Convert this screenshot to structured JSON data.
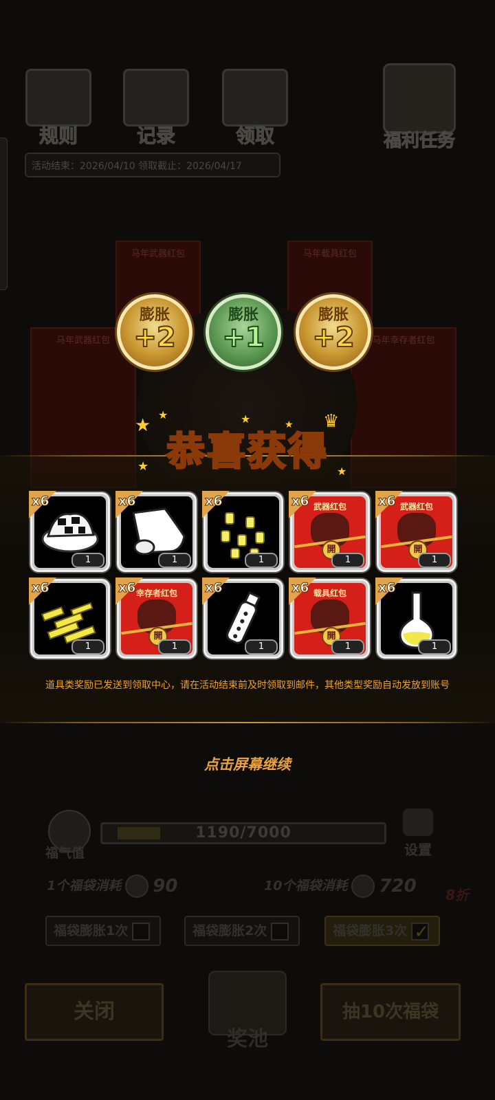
{
  "background": {
    "top_icons": [
      {
        "label": "规则",
        "icon": "rulebook-icon"
      },
      {
        "label": "记录",
        "icon": "record-scroll-icon"
      },
      {
        "label": "领取",
        "icon": "claim-box-icon"
      }
    ],
    "welfare_label": "福利任务",
    "dates": "活动结束：2026/04/10  领取截止：2026/04/17",
    "card_titles": [
      "马年武器红包",
      "马年载具红包",
      "马年武器红包",
      "马年幸存者红包"
    ],
    "bag_label": "開",
    "fortune_label": "福气值",
    "progress_text": "1190/7000",
    "progress_fraction": 0.17,
    "settings_label": "设置",
    "cost_one_label": "1个福袋消耗",
    "cost_one_value": "90",
    "cost_ten_label": "10个福袋消耗",
    "cost_ten_value": "720",
    "coin_label": "福气值",
    "discount": "8折",
    "checkboxes": [
      {
        "label": "福袋膨胀1次",
        "checked": false
      },
      {
        "label": "福袋膨胀2次",
        "checked": false
      },
      {
        "label": "福袋膨胀3次",
        "checked": true
      }
    ],
    "close_label": "关闭",
    "pool_label": "奖池",
    "draw_ten_label": "抽10次福袋"
  },
  "popup": {
    "badges": [
      {
        "word": "膨胀",
        "value": "+2",
        "color": "gold"
      },
      {
        "word": "膨胀",
        "value": "+1",
        "color": "green"
      },
      {
        "word": "膨胀",
        "value": "+2",
        "color": "gold"
      }
    ],
    "title": "恭喜获得",
    "items": [
      {
        "qty": "x6",
        "count": "1",
        "icon": "meat-pile-icon",
        "label": ""
      },
      {
        "qty": "x6",
        "count": "1",
        "icon": "cloth-roll-icon",
        "label": ""
      },
      {
        "qty": "x6",
        "count": "1",
        "icon": "bullets-icon",
        "label": ""
      },
      {
        "qty": "x6",
        "count": "1",
        "icon": "weapon-redpack-icon",
        "label": "武器红包",
        "seal": "開"
      },
      {
        "qty": "x6",
        "count": "1",
        "icon": "weapon-redpack-icon",
        "label": "武器红包",
        "seal": "開"
      },
      {
        "qty": "x6",
        "count": "1",
        "icon": "gold-bars-icon",
        "label": ""
      },
      {
        "qty": "x6",
        "count": "1",
        "icon": "survivor-redpack-icon",
        "label": "幸存者红包",
        "seal": "開"
      },
      {
        "qty": "x6",
        "count": "1",
        "icon": "grenade-icon",
        "label": ""
      },
      {
        "qty": "x6",
        "count": "1",
        "icon": "vehicle-redpack-icon",
        "label": "载具红包",
        "seal": "開"
      },
      {
        "qty": "x6",
        "count": "1",
        "icon": "flask-icon",
        "label": ""
      }
    ],
    "notice": "道具类奖励已发送到领取中心，请在活动结束前及时领取到邮件，其他类型奖励自动发放到账号",
    "tap_continue": "点击屏幕继续"
  },
  "colors": {
    "accent_gold": "#ffc21f",
    "notice_orange": "#f2a31c",
    "redpack_red": "#d5201a",
    "item_corner": "#e2a44a"
  }
}
